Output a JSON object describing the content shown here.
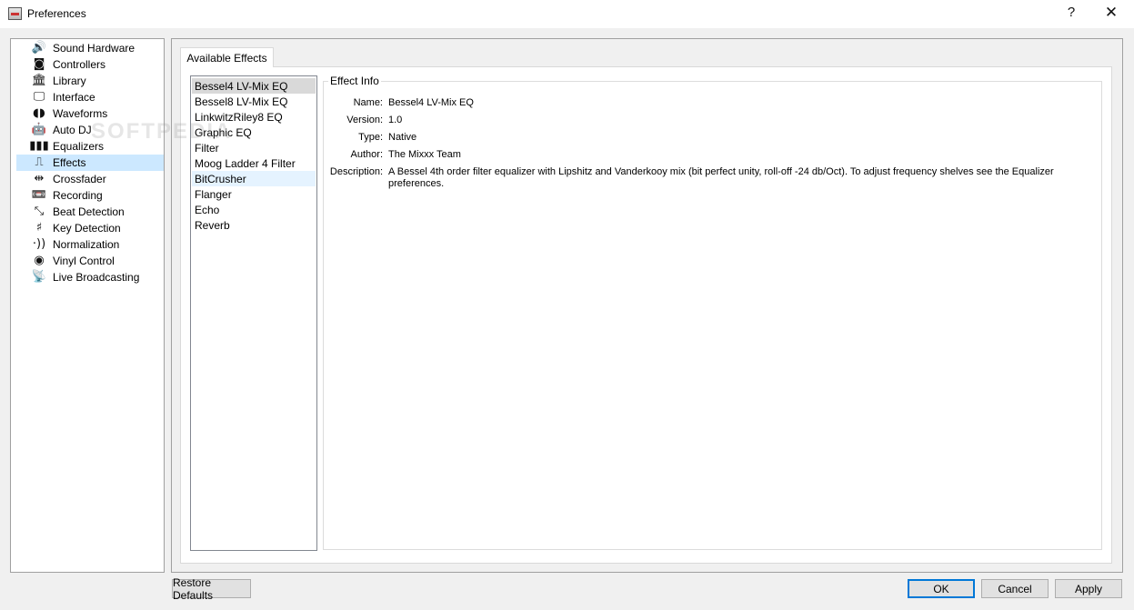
{
  "window": {
    "title": "Preferences",
    "help_glyph": "?",
    "close_glyph": "✕"
  },
  "nav": {
    "items": [
      {
        "label": "Sound Hardware",
        "icon": "speaker-icon",
        "glyph": "🔊"
      },
      {
        "label": "Controllers",
        "icon": "controller-icon",
        "glyph": "◙"
      },
      {
        "label": "Library",
        "icon": "library-icon",
        "glyph": "🏛"
      },
      {
        "label": "Interface",
        "icon": "monitor-icon",
        "glyph": "🖵"
      },
      {
        "label": "Waveforms",
        "icon": "waveform-icon",
        "glyph": "◖◗"
      },
      {
        "label": "Auto DJ",
        "icon": "robot-icon",
        "glyph": "🤖"
      },
      {
        "label": "Equalizers",
        "icon": "equalizer-icon",
        "glyph": "▮▮▮"
      },
      {
        "label": "Effects",
        "icon": "effects-icon",
        "glyph": "⎍"
      },
      {
        "label": "Crossfader",
        "icon": "crossfader-icon",
        "glyph": "⇹"
      },
      {
        "label": "Recording",
        "icon": "cassette-icon",
        "glyph": "📼"
      },
      {
        "label": "Beat Detection",
        "icon": "beat-detection-icon",
        "glyph": "⤡"
      },
      {
        "label": "Key Detection",
        "icon": "key-detection-icon",
        "glyph": "♯"
      },
      {
        "label": "Normalization",
        "icon": "normalization-icon",
        "glyph": "·))"
      },
      {
        "label": "Vinyl Control",
        "icon": "vinyl-icon",
        "glyph": "◉"
      },
      {
        "label": "Live Broadcasting",
        "icon": "broadcast-icon",
        "glyph": "📡"
      }
    ],
    "selected_index": 7
  },
  "tab": {
    "label": "Available Effects"
  },
  "effects": {
    "items": [
      "Bessel4 LV-Mix EQ",
      "Bessel8 LV-Mix EQ",
      "LinkwitzRiley8 EQ",
      "Graphic EQ",
      "Filter",
      "Moog Ladder 4 Filter",
      "BitCrusher",
      "Flanger",
      "Echo",
      "Reverb"
    ],
    "selected_index": 0,
    "hover_index": 6
  },
  "effect_info": {
    "title": "Effect Info",
    "name_label": "Name:",
    "name": "Bessel4 LV-Mix EQ",
    "version_label": "Version:",
    "version": "1.0",
    "type_label": "Type:",
    "type": "Native",
    "author_label": "Author:",
    "author": "The Mixxx Team",
    "description_label": "Description:",
    "description": "A Bessel 4th order filter equalizer with Lipshitz and Vanderkooy mix (bit perfect unity, roll-off -24 db/Oct). To adjust frequency shelves see the Equalizer preferences."
  },
  "watermark": "SOFTPEDIA",
  "buttons": {
    "restore": "Restore Defaults",
    "ok": "OK",
    "cancel": "Cancel",
    "apply": "Apply"
  }
}
